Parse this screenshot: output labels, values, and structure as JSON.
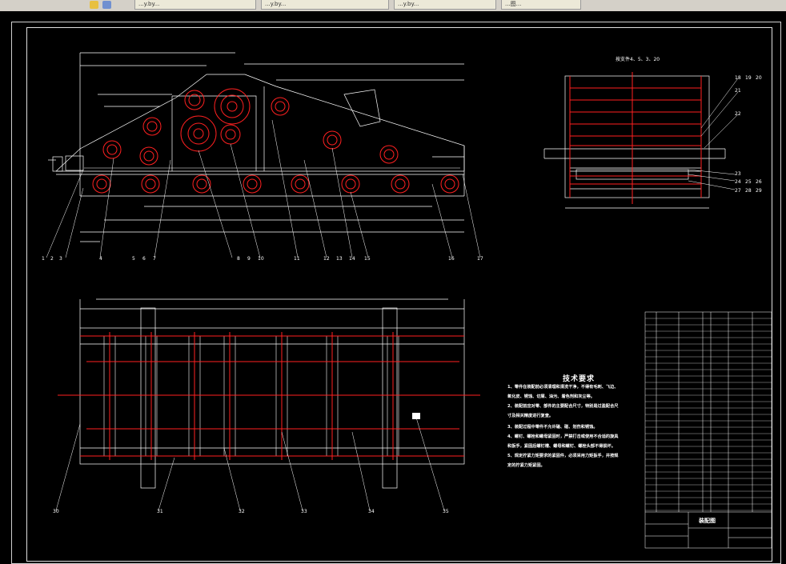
{
  "toolbar": {
    "tabs": [
      {
        "label": "...y.by..."
      },
      {
        "label": "...y.by..."
      },
      {
        "label": "...y.by..."
      },
      {
        "label": "...y.by..."
      },
      {
        "label": "...图..."
      }
    ]
  },
  "drawing": {
    "side_view_label": "按支件4、5、3、20",
    "tech_requirements": {
      "title": "技术要求",
      "lines": [
        "1、零件在装配前必须清理和清洗干净，不得有毛刺、飞边、",
        "氧化皮、锈蚀、切屑、油污、着色剂和灰尘等。",
        "2、装配前应对零、部件的主要配合尺寸，特别是过盈配合尺",
        "寸及相关精度进行复查。",
        "3、装配过程中零件不允许磕、碰、划伤和锈蚀。",
        "4、螺钉、螺栓和螺母紧固时，严禁打击或使用不合适的旋具",
        "和扳手，紧固后螺钉槽、螺母和螺钉、螺栓头部不得损坏。",
        "5、规定拧紧力矩要求的紧固件，必须采用力矩扳手，并按规",
        "定的拧紧力矩紧固。"
      ]
    },
    "title_block": {
      "name": "装配图"
    },
    "callouts_top": [
      "1",
      "2",
      "3",
      "4",
      "5",
      "6",
      "7",
      "8",
      "9",
      "10",
      "11",
      "12",
      "13",
      "14",
      "15",
      "16",
      "17"
    ],
    "callouts_right": [
      "18",
      "19",
      "20",
      "21",
      "22",
      "23",
      "24",
      "25",
      "26",
      "27",
      "28",
      "29"
    ],
    "callouts_bottom": [
      "30",
      "31",
      "32",
      "33",
      "34",
      "35"
    ]
  },
  "colors": {
    "line": "#ffffff",
    "accent": "#ff2020",
    "background": "#000000"
  }
}
